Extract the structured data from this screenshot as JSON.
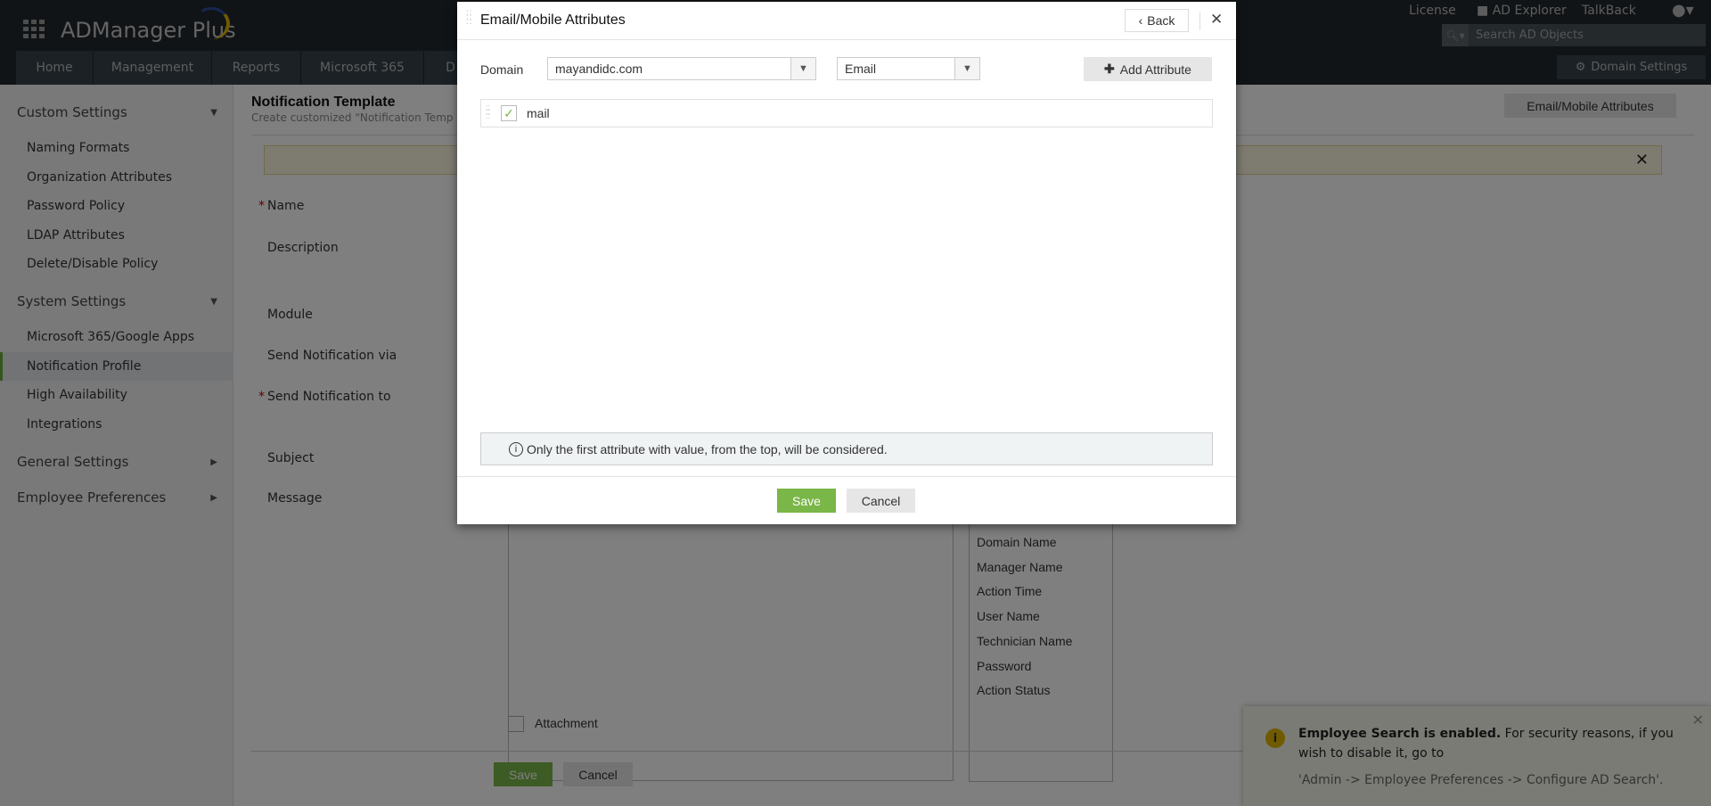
{
  "app": {
    "title": "ADManager Plus",
    "nav_tabs": [
      "Home",
      "Management",
      "Reports",
      "Microsoft 365",
      "D"
    ],
    "top_links": {
      "license": "License",
      "ad_explorer": "AD Explorer",
      "talkback": "TalkBack"
    },
    "search_placeholder": "Search AD Objects",
    "domain_settings": "Domain Settings"
  },
  "sidebar": {
    "sections": [
      {
        "label": "Custom Settings",
        "items": [
          "Naming Formats",
          "Organization Attributes",
          "Password Policy",
          "LDAP Attributes",
          "Delete/Disable Policy"
        ]
      },
      {
        "label": "System Settings",
        "items": [
          "Microsoft 365/Google Apps",
          "Notification Profile",
          "High Availability",
          "Integrations"
        ]
      },
      {
        "label": "General Settings",
        "items": []
      },
      {
        "label": "Employee Preferences",
        "items": []
      }
    ],
    "active": "Notification Profile"
  },
  "main": {
    "title": "Notification Template",
    "subtitle": "Create customized \"Notification Temp",
    "attr_button": "Email/Mobile Attributes",
    "labels": {
      "name": "Name",
      "description": "Description",
      "module": "Module",
      "via": "Send Notification via",
      "to": "Send Notification to",
      "subject": "Subject",
      "message": "Message"
    },
    "required_mark": "*",
    "placeholders": [
      "Domain Name",
      "Manager Name",
      "Action Time",
      "User Name",
      "Technician Name",
      "Password",
      "Action Status"
    ],
    "attachment": "Attachment",
    "save": "Save",
    "cancel": "Cancel"
  },
  "toast": {
    "bold": "Employee Search is enabled.",
    "text": " For security reasons, if you wish to disable it, go to",
    "path": "'Admin -> Employee Preferences -> Configure AD Search'."
  },
  "modal": {
    "title": "Email/Mobile Attributes",
    "back": "Back",
    "domain_label": "Domain",
    "domain_value": "mayandidc.com",
    "type_value": "Email",
    "add_attribute": "Add Attribute",
    "attributes": [
      {
        "name": "mail",
        "checked": true
      }
    ],
    "info": "Only the first attribute with value, from the top, will be considered.",
    "save": "Save",
    "cancel": "Cancel"
  },
  "colors": {
    "accent_green": "#7ab648",
    "topbar": "#22282c",
    "active_marker": "#6bab3e"
  }
}
